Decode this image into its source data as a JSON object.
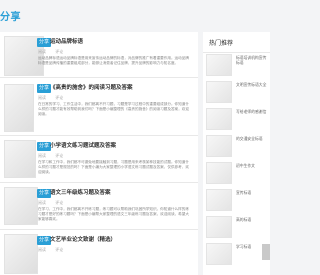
{
  "category": {
    "title": "分享"
  },
  "articles": [
    {
      "badge": "分享",
      "title": "运动品牌标语",
      "meta": [
        "阅读",
        "评论"
      ],
      "excerpt": "运动品牌标语运动品牌标语是用来宣传运动品牌的标语，对品牌的推广有着重要作用。运动品牌标语是品牌传播的重要组成部分，能够让消费者记住品牌，提升品牌的影响力与知名度。"
    },
    {
      "badge": "分享",
      "title": "《高贵的施舍》的阅读习题及答案",
      "meta": [
        "阅读",
        "评论"
      ],
      "excerpt": "在日常的学习、工作生活中，我们都离不开习题，习题是学习过程中的重要组成部分。你知道什么样的习题才能有效帮助到我们吗？下面是小编整理的《高贵的施舍》的阅读习题及答案，欢迎阅读。"
    },
    {
      "badge": "分享",
      "title": "小学语文练习题试题及答案",
      "meta": [
        "阅读",
        "评论"
      ],
      "excerpt": "在学习和工作中，我们都不可避免地要接触到习题，习题是用来考核某种技能的试题。你知道什么样的习题才是规范的吗？下面是小编为大家整理的小学语文练习题试题及答案，仅供参考，欢迎阅读。"
    },
    {
      "badge": "分享",
      "title": "语文三年级练习题及答案",
      "meta": [
        "阅读",
        "评论"
      ],
      "excerpt": "在学习、工作中，我们都离不开练习题，练习题可以帮助我们巩固所学知识。你知道什么样的练习题才是好的练习题吗？下面是小编帮大家整理的语文三年级练习题及答案，欢迎阅读，希望大家能够喜欢。"
    },
    {
      "badge": "分享",
      "title": "文艺毕业论文致谢（精选）",
      "meta": [
        "阅读",
        "评论"
      ],
      "excerpt": ""
    }
  ],
  "sidebar": {
    "heading": "热门推荐",
    "items": [
      {
        "text": "标语培训机构宣传标语"
      },
      {
        "text": "文明宣传标语大全"
      },
      {
        "text": "写给老师的感谢信"
      },
      {
        "text": "的交通安全标语"
      },
      {
        "text": "初中生作文"
      },
      {
        "text": "宣传标语"
      },
      {
        "text": "高的标语"
      },
      {
        "text": "学习标语"
      }
    ]
  }
}
